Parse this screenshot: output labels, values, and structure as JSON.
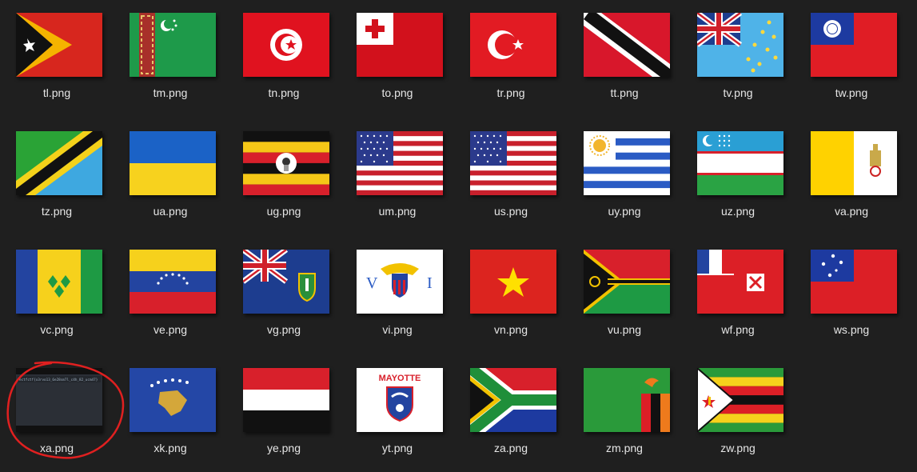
{
  "files": [
    {
      "name": "tl.png",
      "icon": "flag-timor-leste-icon"
    },
    {
      "name": "tm.png",
      "icon": "flag-turkmenistan-icon"
    },
    {
      "name": "tn.png",
      "icon": "flag-tunisia-icon"
    },
    {
      "name": "to.png",
      "icon": "flag-tonga-icon"
    },
    {
      "name": "tr.png",
      "icon": "flag-turkey-icon"
    },
    {
      "name": "tt.png",
      "icon": "flag-trinidad-tobago-icon"
    },
    {
      "name": "tv.png",
      "icon": "flag-tuvalu-icon"
    },
    {
      "name": "tw.png",
      "icon": "flag-taiwan-icon"
    },
    {
      "name": "tz.png",
      "icon": "flag-tanzania-icon"
    },
    {
      "name": "ua.png",
      "icon": "flag-ukraine-icon"
    },
    {
      "name": "ug.png",
      "icon": "flag-uganda-icon"
    },
    {
      "name": "um.png",
      "icon": "flag-us-minor-islands-icon"
    },
    {
      "name": "us.png",
      "icon": "flag-united-states-icon"
    },
    {
      "name": "uy.png",
      "icon": "flag-uruguay-icon"
    },
    {
      "name": "uz.png",
      "icon": "flag-uzbekistan-icon"
    },
    {
      "name": "va.png",
      "icon": "flag-vatican-icon"
    },
    {
      "name": "vc.png",
      "icon": "flag-saint-vincent-icon"
    },
    {
      "name": "ve.png",
      "icon": "flag-venezuela-icon"
    },
    {
      "name": "vg.png",
      "icon": "flag-british-virgin-islands-icon"
    },
    {
      "name": "vi.png",
      "icon": "flag-us-virgin-islands-icon"
    },
    {
      "name": "vn.png",
      "icon": "flag-vietnam-icon"
    },
    {
      "name": "vu.png",
      "icon": "flag-vanuatu-icon"
    },
    {
      "name": "wf.png",
      "icon": "flag-wallis-futuna-icon"
    },
    {
      "name": "ws.png",
      "icon": "flag-samoa-icon"
    },
    {
      "name": "xa.png",
      "icon": "dark-screenshot-thumbnail-icon",
      "thumbnail_text": "ectfctf{x3rvo13_6e28sm7l_c4h_82_ucm47}",
      "highlighted": true
    },
    {
      "name": "xk.png",
      "icon": "flag-kosovo-icon"
    },
    {
      "name": "ye.png",
      "icon": "flag-yemen-icon"
    },
    {
      "name": "yt.png",
      "icon": "flag-mayotte-icon",
      "flag_text": "MAYOTTE"
    },
    {
      "name": "za.png",
      "icon": "flag-south-africa-icon"
    },
    {
      "name": "zm.png",
      "icon": "flag-zambia-icon"
    },
    {
      "name": "zw.png",
      "icon": "flag-zimbabwe-icon"
    }
  ],
  "highlight_color": "#e02020"
}
